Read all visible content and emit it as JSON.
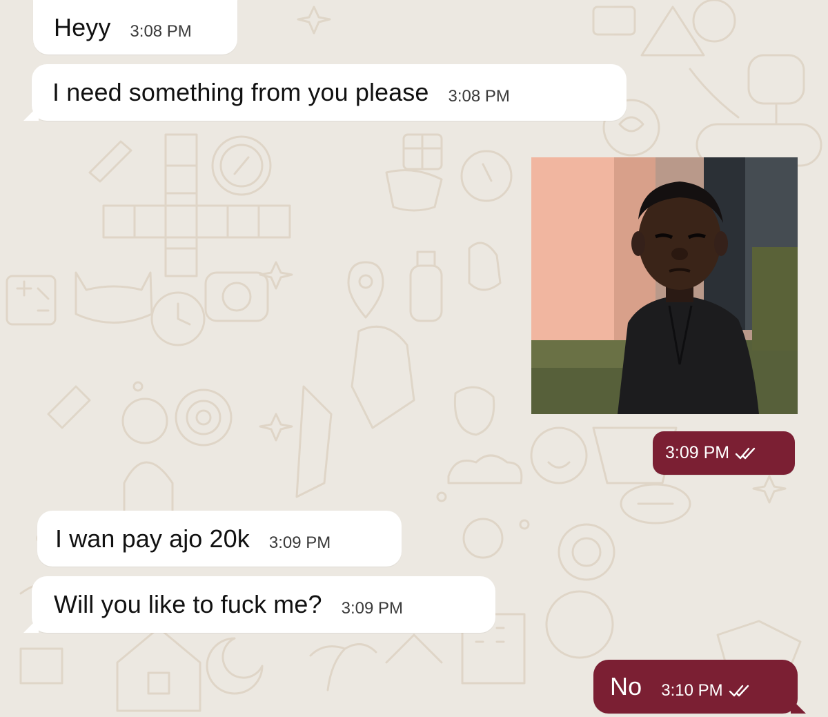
{
  "messages": [
    {
      "direction": "in",
      "text": "Heyy",
      "time": "3:08 PM"
    },
    {
      "direction": "in",
      "text": "I need something from you please",
      "time": "3:08 PM"
    },
    {
      "direction": "out",
      "type": "image",
      "time": "3:09 PM",
      "status": "read-double-check"
    },
    {
      "direction": "in",
      "text": "I wan pay ajo 20k",
      "time": "3:09 PM"
    },
    {
      "direction": "in",
      "text": "Will you like to fuck me?",
      "time": "3:09 PM"
    },
    {
      "direction": "out",
      "text": "No",
      "time": "3:10 PM",
      "status": "read-double-check"
    }
  ],
  "colors": {
    "background": "#ece8e1",
    "incoming_bubble": "#ffffff",
    "outgoing_bubble": "#7b1f33",
    "doodle": "#e0d6c8"
  }
}
